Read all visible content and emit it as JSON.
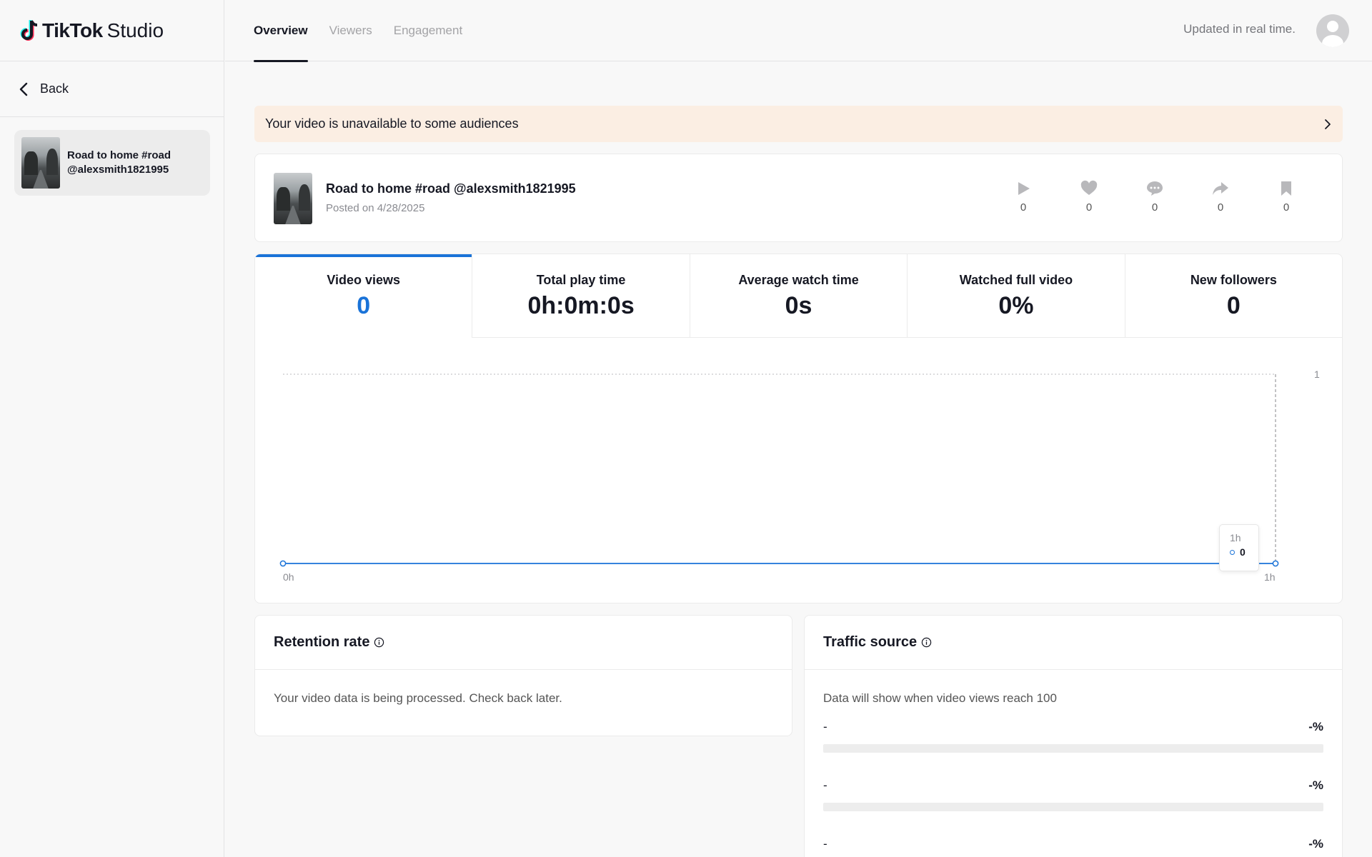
{
  "app": {
    "brand": "TikTok",
    "product": "Studio"
  },
  "sidebar": {
    "back_label": "Back",
    "video_title": "Road to home #road @alexsmith1821995"
  },
  "header": {
    "tabs": [
      {
        "label": "Overview",
        "active": true
      },
      {
        "label": "Viewers",
        "active": false
      },
      {
        "label": "Engagement",
        "active": false
      }
    ],
    "updated_text": "Updated in real time."
  },
  "banner": {
    "text": "Your video is unavailable to some audiences"
  },
  "video": {
    "title": "Road to home #road @alexsmith1821995",
    "posted": "Posted on 4/28/2025",
    "metrics": [
      {
        "icon": "play-icon",
        "value": "0"
      },
      {
        "icon": "heart-icon",
        "value": "0"
      },
      {
        "icon": "comment-icon",
        "value": "0"
      },
      {
        "icon": "share-icon",
        "value": "0"
      },
      {
        "icon": "bookmark-icon",
        "value": "0"
      }
    ]
  },
  "stats": [
    {
      "label": "Video views",
      "value": "0",
      "active": true
    },
    {
      "label": "Total play time",
      "value": "0h:0m:0s",
      "active": false
    },
    {
      "label": "Average watch time",
      "value": "0s",
      "active": false
    },
    {
      "label": "Watched full video",
      "value": "0%",
      "active": false
    },
    {
      "label": "New followers",
      "value": "0",
      "active": false
    }
  ],
  "chart_data": {
    "type": "line",
    "x": [
      "0h",
      "1h"
    ],
    "series": [
      {
        "values": [
          0,
          0
        ]
      }
    ],
    "ylim": [
      0,
      1
    ],
    "y_tick_labels": [
      "1"
    ],
    "x_tick_labels": [
      "0h",
      "1h"
    ],
    "tooltip": {
      "x": "1h",
      "value": "0"
    },
    "accent_color": "#1a73d8"
  },
  "retention": {
    "title": "Retention rate",
    "message": "Your video data is being processed. Check back later."
  },
  "traffic": {
    "title": "Traffic source",
    "message": "Data will show when video views reach 100",
    "rows": [
      {
        "name": "-",
        "pct": "-%"
      },
      {
        "name": "-",
        "pct": "-%"
      },
      {
        "name": "-",
        "pct": "-%"
      }
    ]
  }
}
